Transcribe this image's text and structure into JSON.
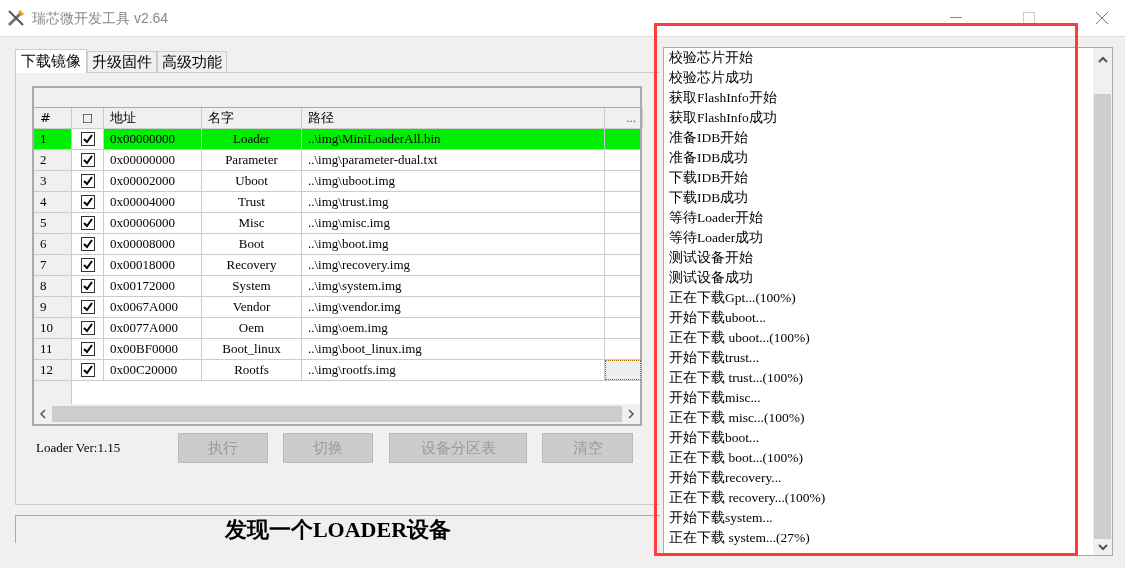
{
  "window": {
    "title": "瑞芯微开发工具 v2.64"
  },
  "tabs": [
    {
      "label": "下载镜像",
      "selected": true
    },
    {
      "label": "升级固件",
      "selected": false
    },
    {
      "label": "高级功能",
      "selected": false
    }
  ],
  "table": {
    "columns": [
      "#",
      "□",
      "地址",
      "名字",
      "路径",
      "..."
    ],
    "rows": [
      {
        "number": "1",
        "checked": true,
        "address": "0x00000000",
        "name": "Loader",
        "path": "..\\img\\MiniLoaderAll.bin",
        "selected": true,
        "focused": false
      },
      {
        "number": "2",
        "checked": true,
        "address": "0x00000000",
        "name": "Parameter",
        "path": "..\\img\\parameter-dual.txt",
        "selected": false,
        "focused": false
      },
      {
        "number": "3",
        "checked": true,
        "address": "0x00002000",
        "name": "Uboot",
        "path": "..\\img\\uboot.img",
        "selected": false,
        "focused": false
      },
      {
        "number": "4",
        "checked": true,
        "address": "0x00004000",
        "name": "Trust",
        "path": "..\\img\\trust.img",
        "selected": false,
        "focused": false
      },
      {
        "number": "5",
        "checked": true,
        "address": "0x00006000",
        "name": "Misc",
        "path": "..\\img\\misc.img",
        "selected": false,
        "focused": false
      },
      {
        "number": "6",
        "checked": true,
        "address": "0x00008000",
        "name": "Boot",
        "path": "..\\img\\boot.img",
        "selected": false,
        "focused": false
      },
      {
        "number": "7",
        "checked": true,
        "address": "0x00018000",
        "name": "Recovery",
        "path": "..\\img\\recovery.img",
        "selected": false,
        "focused": false
      },
      {
        "number": "8",
        "checked": true,
        "address": "0x00172000",
        "name": "System",
        "path": "..\\img\\system.img",
        "selected": false,
        "focused": false
      },
      {
        "number": "9",
        "checked": true,
        "address": "0x0067A000",
        "name": "Vendor",
        "path": "..\\img\\vendor.img",
        "selected": false,
        "focused": false
      },
      {
        "number": "10",
        "checked": true,
        "address": "0x0077A000",
        "name": "Oem",
        "path": "..\\img\\oem.img",
        "selected": false,
        "focused": false
      },
      {
        "number": "11",
        "checked": true,
        "address": "0x00BF0000",
        "name": "Boot_linux",
        "path": "..\\img\\boot_linux.img",
        "selected": false,
        "focused": false
      },
      {
        "number": "12",
        "checked": true,
        "address": "0x00C20000",
        "name": "Rootfs",
        "path": "..\\img\\rootfs.img",
        "selected": false,
        "focused": true
      }
    ]
  },
  "loader_version": "Loader Ver:1.15",
  "buttons": [
    {
      "label": "执行",
      "disabled": true
    },
    {
      "label": "切换",
      "disabled": true
    },
    {
      "label": "设备分区表",
      "disabled": true
    },
    {
      "label": "清空",
      "disabled": true
    }
  ],
  "status": "发现一个LOADER设备",
  "log": [
    "校验芯片开始",
    "校验芯片成功",
    "获取FlashInfo开始",
    "获取FlashInfo成功",
    "准备IDB开始",
    "准备IDB成功",
    "下载IDB开始",
    "下载IDB成功",
    "等待Loader开始",
    "等待Loader成功",
    "测试设备开始",
    "测试设备成功",
    "正在下载Gpt...(100%)",
    "开始下载uboot...",
    "正在下载 uboot...(100%)",
    "开始下载trust...",
    "正在下载 trust...(100%)",
    "开始下载misc...",
    "正在下载 misc...(100%)",
    "开始下载boot...",
    "正在下载 boot...(100%)",
    "开始下载recovery...",
    "正在下载 recovery...(100%)",
    "开始下载system...",
    "正在下载 system...(27%)"
  ]
}
